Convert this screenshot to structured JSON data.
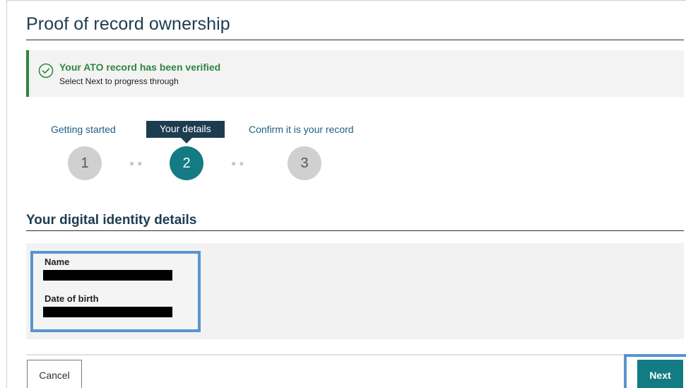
{
  "page": {
    "title": "Proof of record ownership"
  },
  "alert": {
    "icon": "check-circle-icon",
    "title": "Your ATO record has been verified",
    "message": "Select Next to progress through",
    "color": "#2e8540"
  },
  "stepper": {
    "current": 2,
    "steps": [
      {
        "label": "Getting started",
        "number": "1"
      },
      {
        "label": "Your details",
        "number": "2"
      },
      {
        "label": "Confirm it is your record",
        "number": "3"
      }
    ],
    "active_color": "#137b83"
  },
  "section": {
    "title": "Your digital identity details"
  },
  "details": {
    "name_label": "Name",
    "dob_label": "Date of birth"
  },
  "footer": {
    "cancel_label": "Cancel",
    "next_label": "Next"
  }
}
